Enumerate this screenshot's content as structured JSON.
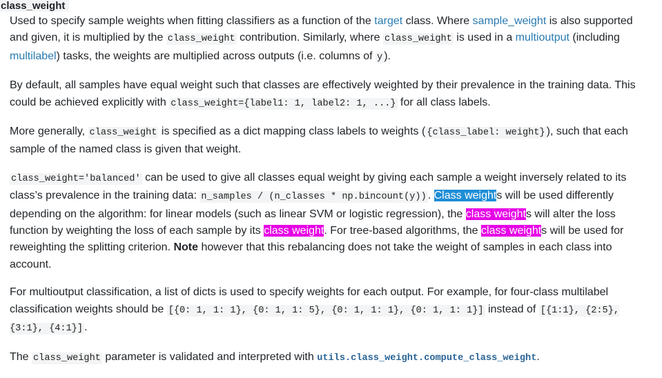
{
  "term": "class_weight",
  "p1": {
    "t1": "Used to specify sample weights when fitting classifiers as a function of the ",
    "link_target": "target",
    "t2": " class. Where ",
    "link_sample_weight": "sample_weight",
    "t3": " is also supported and given, it is multiplied by the ",
    "code1": "class_weight",
    "t4": " contribution. Similarly, where ",
    "code2": "class_weight",
    "t5": " is used in a ",
    "link_multioutput": "multioutput",
    "t6": " (including ",
    "link_multilabel": "multilabel",
    "t7": ") tasks, the weights are multiplied across outputs (i.e. columns of ",
    "code3": "y",
    "t8": ")."
  },
  "p2": {
    "t1": "By default, all samples have equal weight such that classes are effectively weighted by their prevalence in the training data. This could be achieved explicitly with ",
    "code1": "class_weight={label1: 1, label2: 1, ...}",
    "t2": " for all class labels."
  },
  "p3": {
    "t1": "More generally, ",
    "code1": "class_weight",
    "t2": " is specified as a dict mapping class labels to weights (",
    "code2": "{class_label: weight}",
    "t3": "), such that each sample of the named class is given that weight."
  },
  "p4": {
    "code1": "class_weight='balanced'",
    "t1": " can be used to give all classes equal weight by giving each sample a weight inversely related to its class’s prevalence in the training data: ",
    "code2": "n_samples / (n_classes * np.bincount(y))",
    "t2": ". ",
    "hl1": "Class weight",
    "t3": "s will be used differently depending on the algorithm: for linear models (such as linear SVM or logistic regression), the ",
    "hl2": "class weight",
    "t4": "s will alter the loss function by weighting the loss of each sample by its ",
    "hl3": "class weight",
    "t5": ". For tree-based algorithms, the ",
    "hl4": "class weight",
    "t6": "s will be used for reweighting the splitting criterion. ",
    "strong": "Note",
    "t7": " however that this rebalancing does not take the weight of samples in each class into account."
  },
  "p5": {
    "t1": "For multioutput classification, a list of dicts is used to specify weights for each output. For example, for four-class multilabel classification weights should be ",
    "code1": "[{0: 1, 1: 1}, {0: 1, 1: 5}, {0: 1, 1: 1}, {0: 1, 1: 1}]",
    "t2": " instead of ",
    "code2": "[{1:1}, {2:5}, {3:1}, {4:1}]",
    "t3": "."
  },
  "p6": {
    "t1": "The ",
    "code1": "class_weight",
    "t2": " parameter is validated and interpreted with ",
    "link_api": "utils.class_weight.compute_class_weight",
    "t3": "."
  },
  "colors": {
    "link": "#2a7ab0",
    "highlight_current": "#1f8ed6",
    "highlight_match": "#e600e6"
  }
}
